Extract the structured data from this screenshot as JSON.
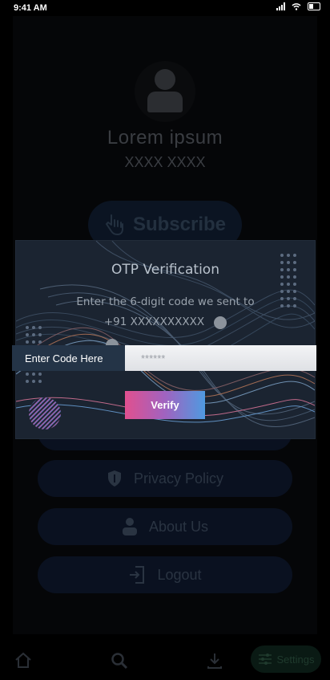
{
  "status_bar": {
    "time": "9:41 AM"
  },
  "profile": {
    "name": "Lorem ipsum",
    "subtitle": "XXXX XXXX"
  },
  "subscribe": {
    "label": "Subscribe"
  },
  "menu": [
    {
      "label": "",
      "icon": "document-icon"
    },
    {
      "label": "Privacy Policy",
      "icon": "shield-icon"
    },
    {
      "label": "About Us",
      "icon": "person-icon"
    },
    {
      "label": "Logout",
      "icon": "logout-icon"
    }
  ],
  "bottom_nav": {
    "items": [
      {
        "icon": "home-icon"
      },
      {
        "icon": "search-icon"
      },
      {
        "icon": "download-icon"
      }
    ],
    "settings_label": "Settings"
  },
  "otp_modal": {
    "title": "OTP Verification",
    "description": "Enter the 6-digit code we sent to",
    "phone": "+91 XXXXXXXXXX",
    "code_label": "Enter Code Here",
    "code_placeholder": "******",
    "code_value": "",
    "verify_label": "Verify"
  },
  "colors": {
    "modal_bg": "#1b2431",
    "accent_pink": "#e0508f",
    "accent_blue": "#4f9ae0"
  }
}
